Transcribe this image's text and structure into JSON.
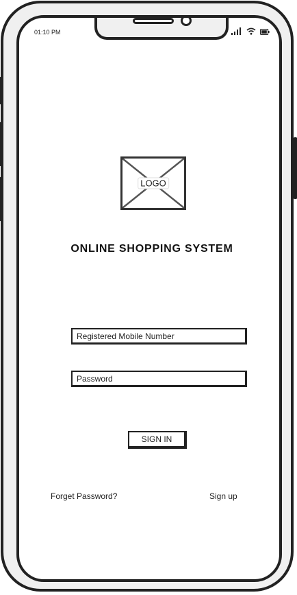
{
  "status_bar": {
    "time": "01:10 PM",
    "icons": [
      "signal-icon",
      "wifi-icon",
      "battery-icon"
    ]
  },
  "logo": {
    "label": "LOGO"
  },
  "title": "ONLINE SHOPPING SYSTEM",
  "form": {
    "mobile_placeholder": "Registered Mobile Number",
    "password_placeholder": "Password",
    "signin_label": "SIGN IN"
  },
  "links": {
    "forgot_password": "Forget Password?",
    "sign_up": "Sign up"
  },
  "colors": {
    "stroke": "#222222",
    "background": "#ffffff",
    "frame": "#f0f0f0"
  }
}
